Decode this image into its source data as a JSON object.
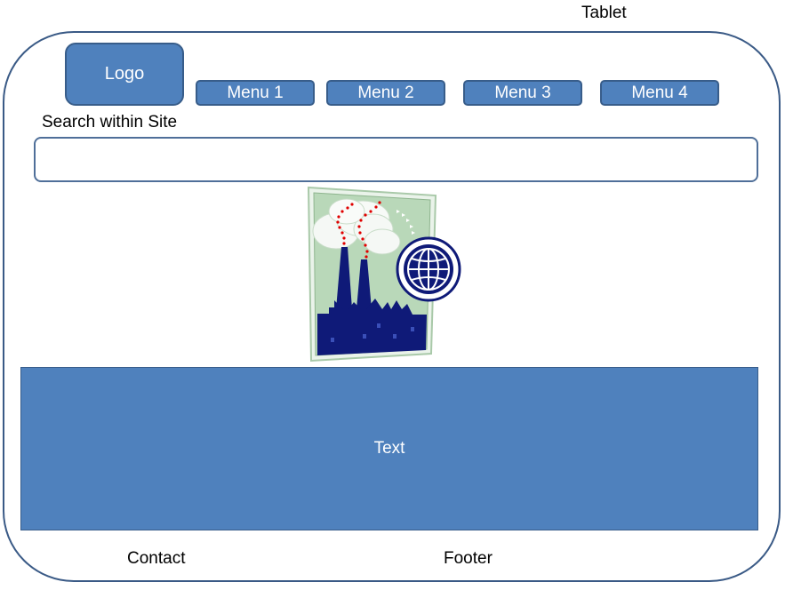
{
  "device_label": "Tablet",
  "header": {
    "logo_label": "Logo",
    "menu": [
      {
        "label": "Menu 1"
      },
      {
        "label": "Menu 2"
      },
      {
        "label": "Menu 3"
      },
      {
        "label": "Menu 4"
      }
    ]
  },
  "search": {
    "label": "Search within Site",
    "value": ""
  },
  "hero": {
    "icon": "factory-globe-clipart"
  },
  "content": {
    "text": "Text"
  },
  "footer": {
    "contact_label": "Contact",
    "footer_label": "Footer"
  },
  "colors": {
    "accent": "#4f81bd",
    "accent_border": "#385d8a",
    "frame_border": "#3a5a86"
  }
}
